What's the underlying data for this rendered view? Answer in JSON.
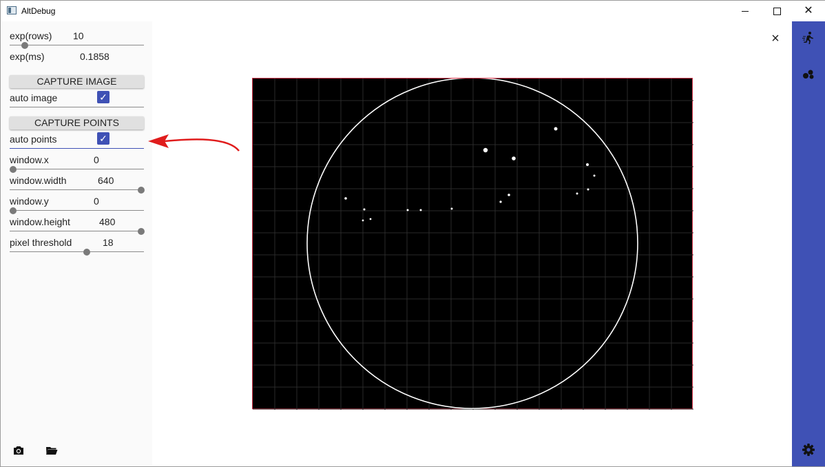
{
  "window": {
    "title": "AltDebug"
  },
  "controls": {
    "exp_rows": {
      "label": "exp(rows)",
      "value": "10",
      "fraction": 0.12
    },
    "exp_ms": {
      "label": "exp(ms)",
      "value": "0.1858"
    },
    "capture_image": {
      "label": "CAPTURE IMAGE"
    },
    "auto_image": {
      "label": "auto image",
      "checked": true
    },
    "capture_points": {
      "label": "CAPTURE POINTS"
    },
    "auto_points": {
      "label": "auto points",
      "checked": true
    },
    "window_x": {
      "label": "window.x",
      "value": "0",
      "fraction": 0.0
    },
    "window_width": {
      "label": "window.width",
      "value": "640",
      "fraction": 1.0
    },
    "window_y": {
      "label": "window.y",
      "value": "0",
      "fraction": 0.0
    },
    "window_height": {
      "label": "window.height",
      "value": "480",
      "fraction": 1.0
    },
    "pixel_threshold": {
      "label": "pixel threshold",
      "value": "18",
      "fraction": 0.57
    }
  },
  "bottom_toolbar": {
    "icons": [
      "camera-icon",
      "folder-open-icon"
    ]
  },
  "sidebar": {
    "icons": [
      "run-icon",
      "bubbles-icon",
      "gear-icon"
    ],
    "color": "#3f51b5"
  },
  "overlay": {
    "close_glyph": "×"
  },
  "colors": {
    "accent": "#3f51b5",
    "canvas_border": "#d8344a",
    "arrow": "#e01c1c"
  }
}
